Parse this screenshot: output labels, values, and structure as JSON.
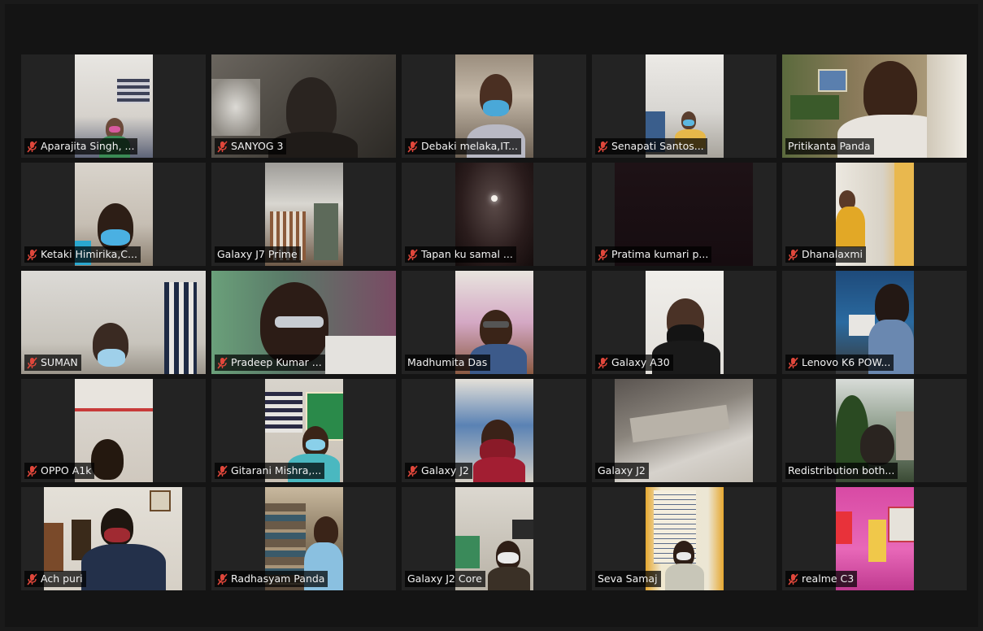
{
  "participants": [
    {
      "name": "Aparajita Singh, ...",
      "muted": true
    },
    {
      "name": "SANYOG 3",
      "muted": true
    },
    {
      "name": "Debaki melaka,IT...",
      "muted": true
    },
    {
      "name": "Senapati Santos...",
      "muted": true
    },
    {
      "name": "Pritikanta Panda",
      "muted": false,
      "active_speaker": true
    },
    {
      "name": "Ketaki Himirika,C...",
      "muted": true
    },
    {
      "name": "Galaxy J7 Prime",
      "muted": false
    },
    {
      "name": "Tapan ku samal ...",
      "muted": true
    },
    {
      "name": "Pratima kumari p...",
      "muted": true
    },
    {
      "name": "Dhanalaxmi",
      "muted": true
    },
    {
      "name": "SUMAN",
      "muted": true
    },
    {
      "name": "Pradeep Kumar ...",
      "muted": true
    },
    {
      "name": "Madhumita Das",
      "muted": false
    },
    {
      "name": "Galaxy A30",
      "muted": true
    },
    {
      "name": "Lenovo K6 POW...",
      "muted": true
    },
    {
      "name": "OPPO A1k",
      "muted": true
    },
    {
      "name": "Gitarani Mishra,...",
      "muted": true
    },
    {
      "name": "Galaxy J2",
      "muted": true
    },
    {
      "name": "Galaxy J2",
      "muted": false
    },
    {
      "name": "Redistribution both...",
      "muted": false
    },
    {
      "name": "Ach puri",
      "muted": true
    },
    {
      "name": "Radhasyam Panda",
      "muted": true
    },
    {
      "name": "Galaxy J2 Core",
      "muted": false
    },
    {
      "name": "Seva Samaj",
      "muted": false
    },
    {
      "name": "realme C3",
      "muted": true
    }
  ],
  "colors": {
    "background": "#141414",
    "tile": "#232323",
    "active_border": "#c9dc52",
    "muted_icon": "#e0473b"
  }
}
